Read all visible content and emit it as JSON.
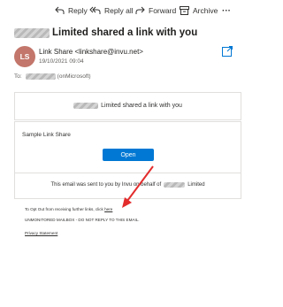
{
  "toolbar": {
    "reply_label": "Reply",
    "reply_all_label": "Reply all",
    "forward_label": "Forward",
    "archive_label": "Archive",
    "more_label": "···"
  },
  "email": {
    "subject": "Limited shared a link with you",
    "sender_initials": "LS",
    "sender": "Link Share <linkshare@invu.net>",
    "date": "19/10/2021 09:04",
    "to_label": "To:",
    "to_suffix": "(onMicrosoft)"
  },
  "body": {
    "shared_text": "Limited shared a link with you",
    "link_share_label": "Sample Link Share",
    "open_button": "Open",
    "sent_by_prefix": "This email was sent to you by Invu on behalf of",
    "sent_by_suffix": "Limited"
  },
  "footer": {
    "opt_out_text": "To Opt Out from receiving further links, click",
    "opt_out_link": "here",
    "unmonitored": "UNMONITORED MAILBOX - DO NOT REPLY TO THIS EMAIL.",
    "privacy": "Privacy Statement"
  },
  "colors": {
    "avatar_bg": "#c3766b",
    "open_button_bg": "#0078d4",
    "arrow": "#e32c2c",
    "redaction": "#c8c8c8"
  },
  "icons": [
    "reply-icon",
    "reply-all-icon",
    "forward-icon",
    "archive-icon",
    "popout-icon",
    "red-arrow-annotation"
  ]
}
